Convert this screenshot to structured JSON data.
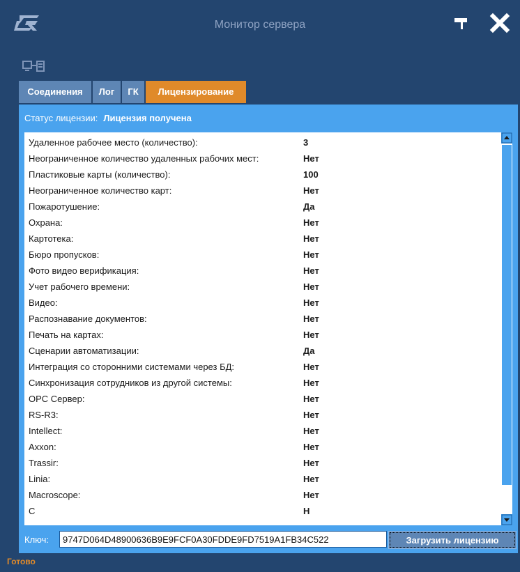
{
  "window": {
    "title": "Монитор сервера"
  },
  "tabs": [
    {
      "label": "Соединения"
    },
    {
      "label": "Лог"
    },
    {
      "label": "ГК"
    },
    {
      "label": "Лицензирование"
    }
  ],
  "license": {
    "status_label": "Статус лицензии:",
    "status_value": "Лицензия получена",
    "rows": [
      {
        "label": "Удаленное рабочее место (количество):",
        "value": "3"
      },
      {
        "label": "Неограниченное количество удаленных рабочих мест:",
        "value": "Нет"
      },
      {
        "label": "Пластиковые карты (количество):",
        "value": "100"
      },
      {
        "label": "Неограниченное количество карт:",
        "value": "Нет"
      },
      {
        "label": "Пожаротушение:",
        "value": "Да"
      },
      {
        "label": "Охрана:",
        "value": "Нет"
      },
      {
        "label": "Картотека:",
        "value": "Нет"
      },
      {
        "label": "Бюро пропусков:",
        "value": "Нет"
      },
      {
        "label": "Фото видео верификация:",
        "value": "Нет"
      },
      {
        "label": "Учет рабочего времени:",
        "value": "Нет"
      },
      {
        "label": "Видео:",
        "value": "Нет"
      },
      {
        "label": "Распознавание документов:",
        "value": "Нет"
      },
      {
        "label": "Печать на картах:",
        "value": "Нет"
      },
      {
        "label": "Сценарии автоматизации:",
        "value": "Да"
      },
      {
        "label": "Интеграция со сторонними системами через БД:",
        "value": "Нет"
      },
      {
        "label": "Синхронизация сотрудников из другой системы:",
        "value": "Нет"
      },
      {
        "label": "OPC Сервер:",
        "value": "Нет"
      },
      {
        "label": "RS-R3:",
        "value": "Нет"
      },
      {
        "label": "Intellect:",
        "value": "Нет"
      },
      {
        "label": "Axxon:",
        "value": "Нет"
      },
      {
        "label": "Trassir:",
        "value": "Нет"
      },
      {
        "label": "Linia:",
        "value": "Нет"
      },
      {
        "label": "Macroscope:",
        "value": "Нет"
      },
      {
        "label": "C",
        "value": "Н"
      }
    ],
    "key_label": "Ключ:",
    "key_value": "9747D064D48900636B9E9FCF0A30FDDE9FD7519A1FB34C522",
    "load_button": "Загрузить лицензию"
  },
  "status_bar": {
    "text": "Готово"
  },
  "icons": {
    "logo": "logo-icon",
    "flag": "flag-icon",
    "close": "close-icon",
    "server": "server-connection-icon",
    "scroll_up": "scroll-up-icon",
    "scroll_down": "scroll-down-icon"
  },
  "colors": {
    "window_bg": "#23456f",
    "panel_bg": "#4aa3ee",
    "tab_inactive": "#5e86b5",
    "tab_active": "#e08a2a",
    "status_ready": "#e08a2a"
  }
}
